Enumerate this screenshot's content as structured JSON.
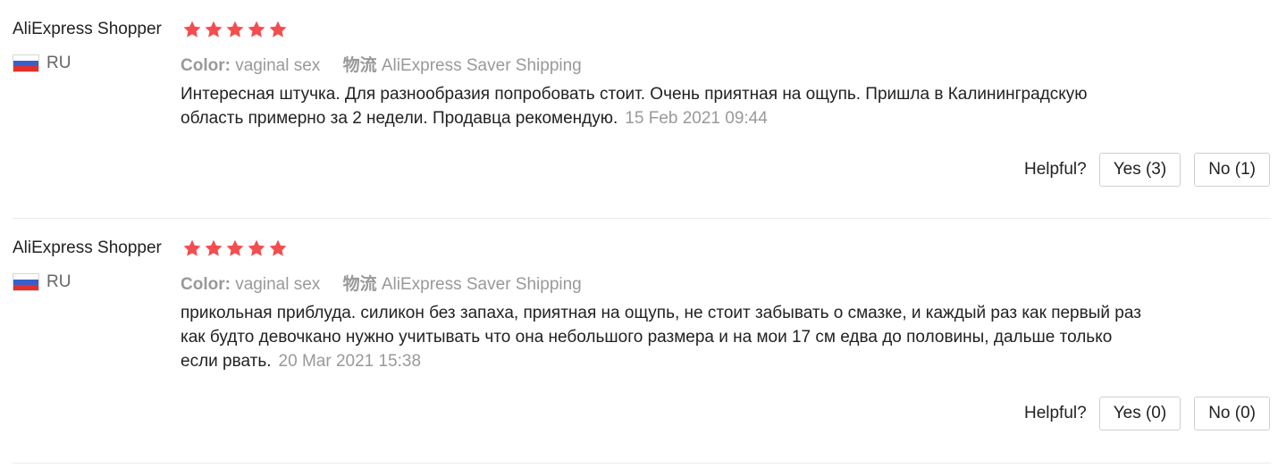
{
  "colors": {
    "star": "#f44d4f",
    "muted": "#999999",
    "divider": "#ebebeb"
  },
  "reviews": [
    {
      "user": "AliExpress Shopper",
      "rating": 5,
      "country_code": "RU",
      "color_label": "Color:",
      "color_value": "vaginal sex",
      "shipping_label": "物流",
      "shipping_value": "AliExpress Saver Shipping",
      "text": "Интересная штучка. Для разнообразия попробовать стоит. Очень приятная на ощупь. Пришла в Калининградскую область примерно за 2 недели. Продавца рекомендую.",
      "date": "15 Feb 2021 09:44",
      "helpful_label": "Helpful?",
      "yes_label": "Yes (3)",
      "no_label": "No (1)"
    },
    {
      "user": "AliExpress Shopper",
      "rating": 5,
      "country_code": "RU",
      "color_label": "Color:",
      "color_value": "vaginal sex",
      "shipping_label": "物流",
      "shipping_value": "AliExpress Saver Shipping",
      "text": "прикольная приблуда. силикон без запаха, приятная на ощупь, не стоит забывать о смазке, и каждый раз как первый раз как будто девочкано нужно учитывать что она небольшого размера и на мои 17 см едва до половины, дальше только если рвать.",
      "date": "20 Mar 2021 15:38",
      "helpful_label": "Helpful?",
      "yes_label": "Yes (0)",
      "no_label": "No (0)"
    }
  ]
}
